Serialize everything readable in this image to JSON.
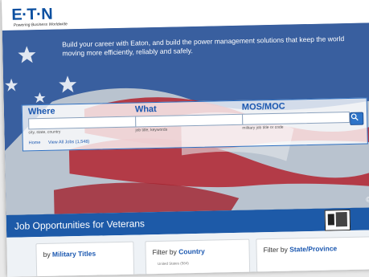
{
  "header": {
    "logo": "E·T·N",
    "tagline": "Powering Business Worldwide"
  },
  "hero": {
    "intro": "Build your career with Eaton, and build the power management solutions that keep the world moving more efficiently, reliably and safely.",
    "copyright_glyph": "©"
  },
  "search": {
    "where": {
      "label": "Where",
      "hint": "city, state, country",
      "placeholder": ""
    },
    "what": {
      "label": "What",
      "hint": "job title, keywords",
      "placeholder": ""
    },
    "mos": {
      "label": "MOS/MOC",
      "hint": "military job title or code",
      "placeholder": ""
    },
    "go_icon": "search-icon",
    "links": {
      "home": "Home",
      "view_all": "View All Jobs (1,548)"
    }
  },
  "banner": {
    "title": "Job Opportunities for Veterans"
  },
  "filters": {
    "military": {
      "prefix": "by ",
      "highlight": "Military Titles"
    },
    "country": {
      "prefix": "Filter by ",
      "highlight": "Country",
      "first_item": "United States (584)"
    },
    "state": {
      "prefix": "Filter by ",
      "highlight": "State/Province"
    }
  },
  "colors": {
    "brand_blue": "#1d5aa8",
    "link_blue": "#1a57b0"
  }
}
